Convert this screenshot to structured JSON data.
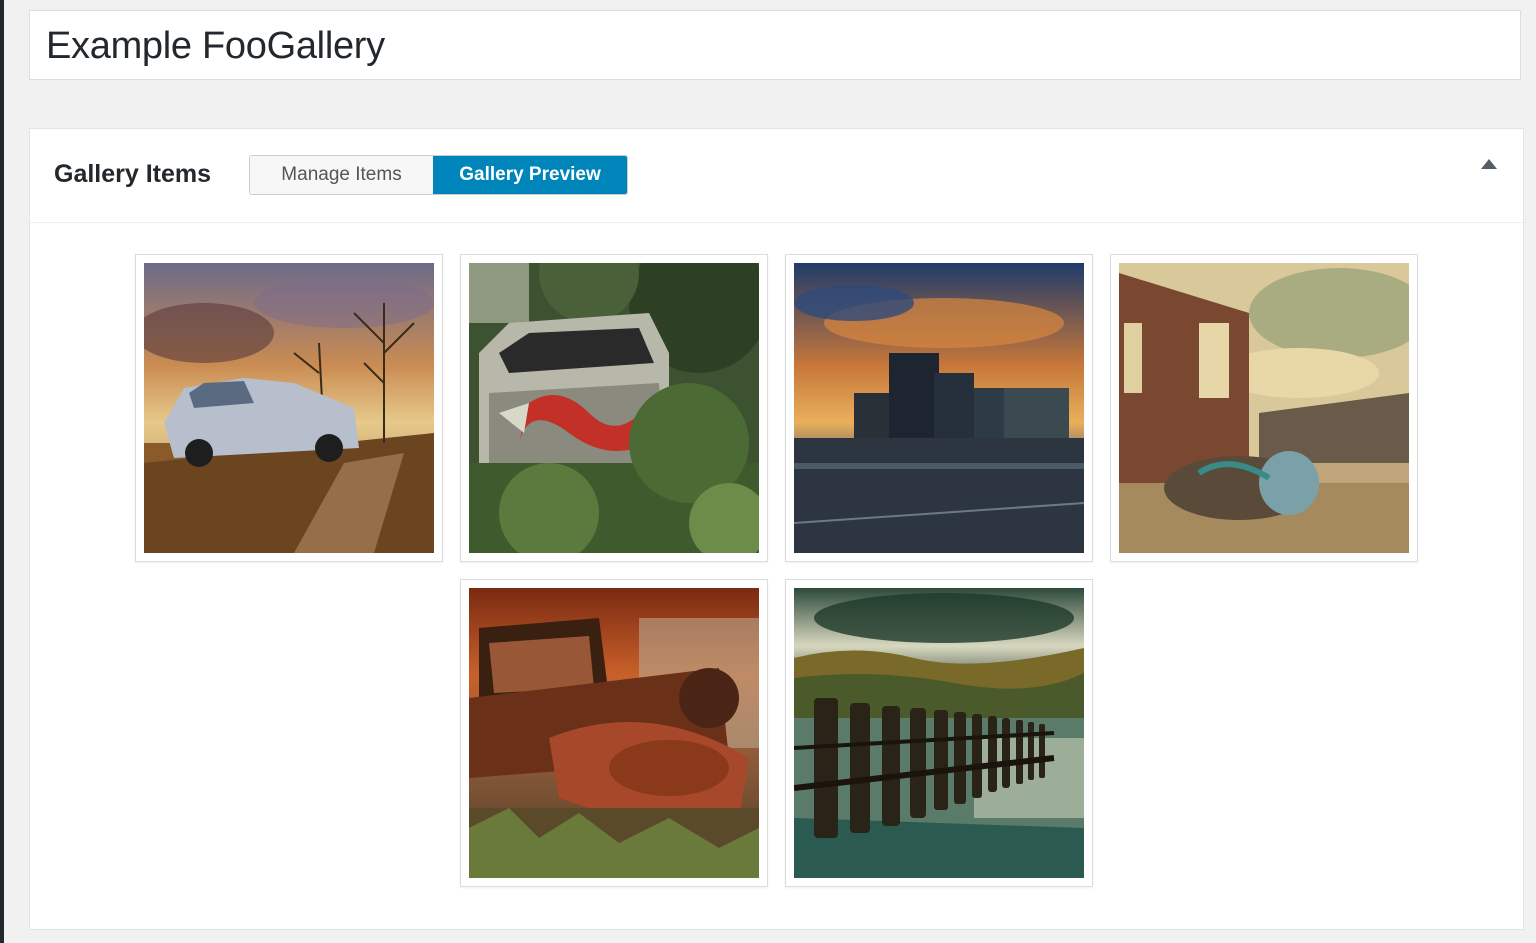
{
  "post": {
    "title": "Example FooGallery"
  },
  "metabox": {
    "title": "Gallery Items",
    "tabs": [
      {
        "label": "Manage Items",
        "active": false
      },
      {
        "label": "Gallery Preview",
        "active": true
      }
    ],
    "toggle_icon": "triangle-up-icon",
    "accent_color": "#0085ba"
  },
  "gallery": {
    "items": [
      {
        "subject": "abandoned car under dramatic sky"
      },
      {
        "subject": "graffiti-covered wrecked van in overgrowth"
      },
      {
        "subject": "city skyline at sunset"
      },
      {
        "subject": "brick building with graffiti pipe"
      },
      {
        "subject": "rusted vintage truck"
      },
      {
        "subject": "wooden fence by lake under storm clouds"
      }
    ]
  }
}
